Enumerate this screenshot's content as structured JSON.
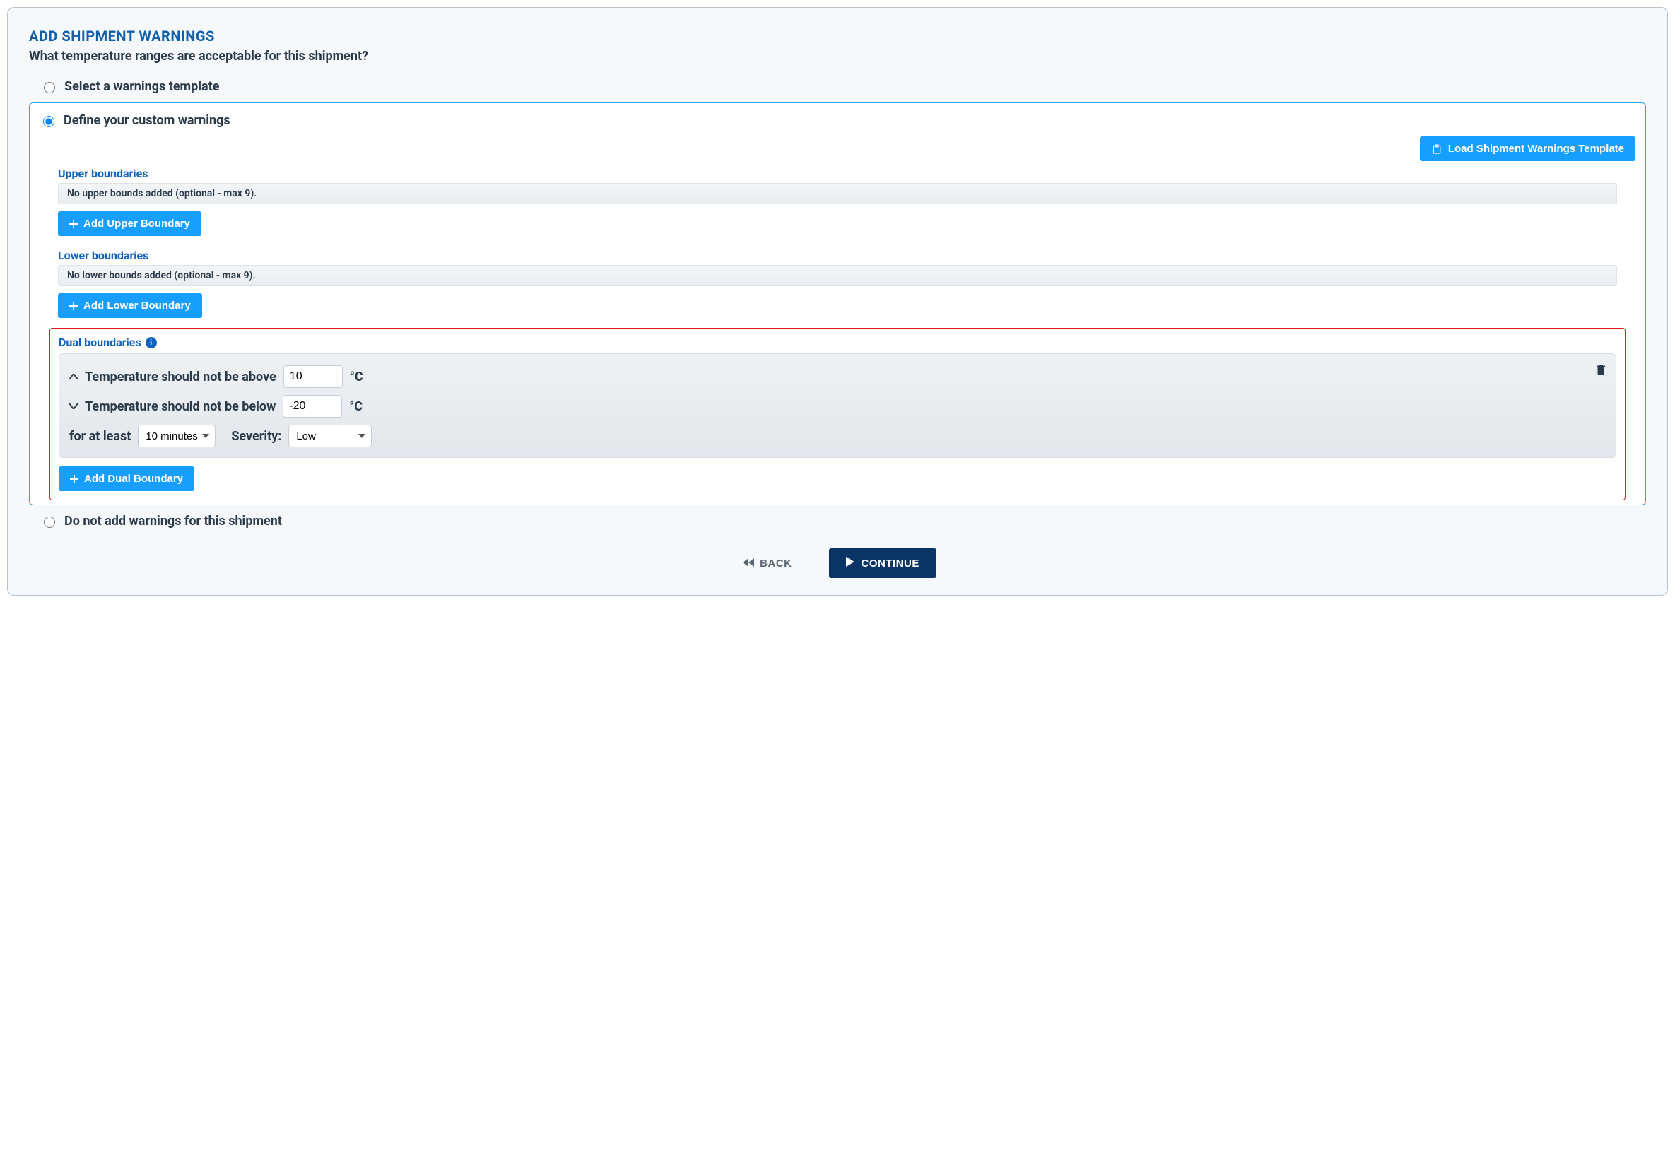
{
  "header": {
    "title": "ADD SHIPMENT WARNINGS",
    "subtitle": "What temperature ranges are acceptable for this shipment?"
  },
  "options": {
    "template_label": "Select a warnings template",
    "custom_label": "Define your custom warnings",
    "none_label": "Do not add warnings for this shipment"
  },
  "buttons": {
    "load_template": "Load Shipment Warnings Template",
    "add_upper": "Add Upper Boundary",
    "add_lower": "Add Lower Boundary",
    "add_dual": "Add Dual Boundary",
    "back": "BACK",
    "continue": "CONTINUE"
  },
  "sections": {
    "upper": {
      "title": "Upper boundaries",
      "empty": "No upper bounds added (optional - max 9)."
    },
    "lower": {
      "title": "Lower boundaries",
      "empty": "No lower bounds added (optional - max 9)."
    },
    "dual": {
      "title": "Dual boundaries"
    }
  },
  "dual_card": {
    "above_label": "Temperature should not be above",
    "above_value": "10",
    "below_label": "Temperature should not be below",
    "below_value": "-20",
    "unit": "°C",
    "for_at_least": "for at least",
    "duration_value": "10 minutes",
    "severity_label": "Severity:",
    "severity_value": "Low"
  }
}
